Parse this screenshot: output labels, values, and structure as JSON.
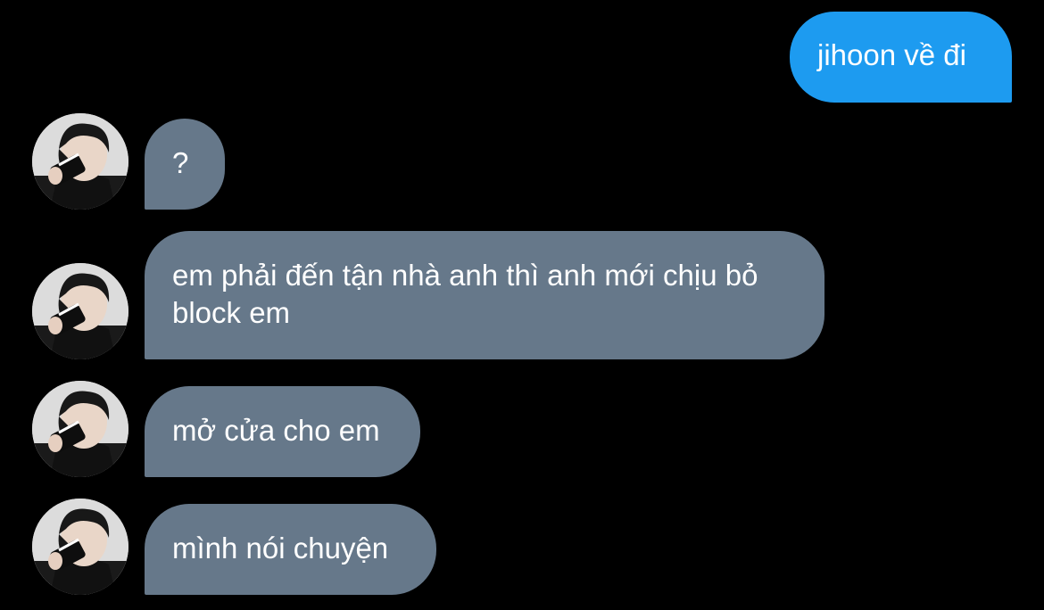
{
  "messages": [
    {
      "from": "me",
      "text": "jihoon về đi"
    },
    {
      "from": "them",
      "text": "?"
    },
    {
      "from": "them",
      "text": "em phải đến tận nhà anh thì anh mới chịu bỏ block em"
    },
    {
      "from": "them",
      "text": "mở cửa cho em"
    },
    {
      "from": "them",
      "text": "mình nói chuyện"
    }
  ],
  "colors": {
    "background": "#000000",
    "sent_bubble": "#1d9bf0",
    "received_bubble": "#66788a",
    "text": "#ffffff"
  },
  "icons": {
    "avatar": "contact-avatar-photo"
  }
}
